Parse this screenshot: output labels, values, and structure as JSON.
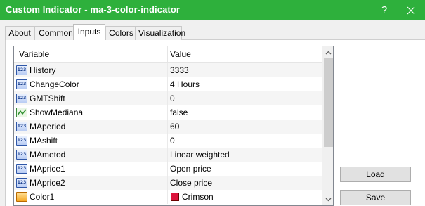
{
  "window": {
    "title": "Custom Indicator - ma-3-color-indicator",
    "help_label": "?",
    "accent_color": "#2eb03c"
  },
  "tabs": [
    {
      "label": "About",
      "active": false
    },
    {
      "label": "Common",
      "active": false
    },
    {
      "label": "Inputs",
      "active": true
    },
    {
      "label": "Colors",
      "active": false
    },
    {
      "label": "Visualization",
      "active": false
    }
  ],
  "grid": {
    "headers": {
      "variable": "Variable",
      "value": "Value"
    },
    "rows": [
      {
        "name": "History",
        "value": "3333",
        "type": "int",
        "icon_text": "123"
      },
      {
        "name": "ChangeColor",
        "value": "4 Hours",
        "type": "enum",
        "icon_text": "123"
      },
      {
        "name": "GMTShift",
        "value": "0",
        "type": "int",
        "icon_text": "123"
      },
      {
        "name": "ShowMediana",
        "value": "false",
        "type": "bool"
      },
      {
        "name": "MAperiod",
        "value": "60",
        "type": "int",
        "icon_text": "123"
      },
      {
        "name": "MAshift",
        "value": "0",
        "type": "int",
        "icon_text": "123"
      },
      {
        "name": "MAmetod",
        "value": "Linear weighted",
        "type": "enum",
        "icon_text": "123"
      },
      {
        "name": "MAprice1",
        "value": "Open price",
        "type": "enum",
        "icon_text": "123"
      },
      {
        "name": "MAprice2",
        "value": "Close price",
        "type": "enum",
        "icon_text": "123"
      },
      {
        "name": "Color1",
        "value": "Crimson",
        "type": "color",
        "swatch": "#dc143c"
      }
    ]
  },
  "buttons": {
    "load_label": "Load",
    "save_label": "Save"
  }
}
